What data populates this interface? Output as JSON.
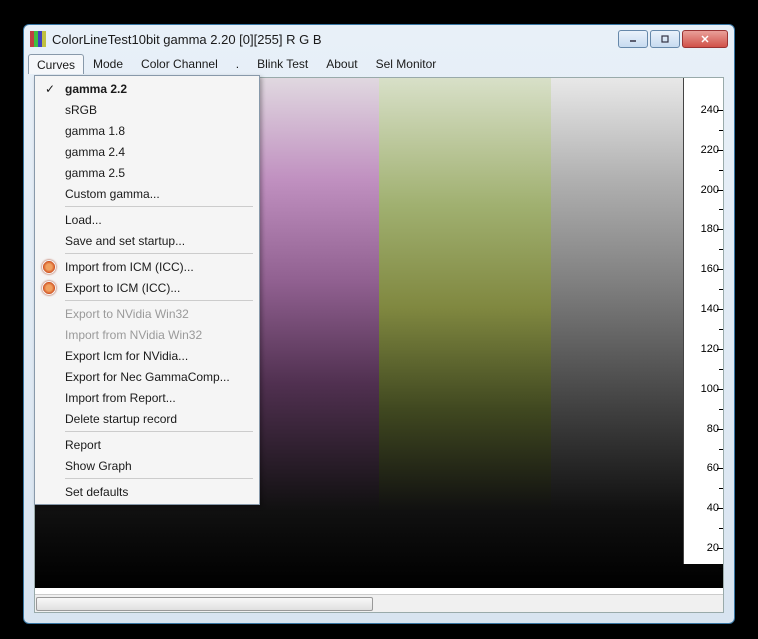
{
  "window": {
    "title": "ColorLineTest10bit gamma 2.20 [0][255]   R G B"
  },
  "menubar": {
    "items": [
      {
        "label": "Curves",
        "open": true
      },
      {
        "label": "Mode"
      },
      {
        "label": "Color Channel"
      },
      {
        "label": "."
      },
      {
        "label": "Blink Test"
      },
      {
        "label": "About"
      },
      {
        "label": "Sel Monitor"
      }
    ]
  },
  "dropdown": {
    "groups": [
      [
        {
          "label": "gamma 2.2",
          "selected": true
        },
        {
          "label": "sRGB"
        },
        {
          "label": "gamma 1.8"
        },
        {
          "label": "gamma 2.4"
        },
        {
          "label": "gamma 2.5"
        },
        {
          "label": "Custom gamma..."
        }
      ],
      [
        {
          "label": "Load..."
        },
        {
          "label": "Save and set startup..."
        }
      ],
      [
        {
          "label": "Import from ICM (ICC)...",
          "icon": "gear"
        },
        {
          "label": "Export to ICM (ICC)...",
          "icon": "gear"
        }
      ],
      [
        {
          "label": "Export to NVidia Win32",
          "disabled": true
        },
        {
          "label": "Import from NVidia Win32",
          "disabled": true
        },
        {
          "label": "Export Icm for NVidia..."
        },
        {
          "label": "Export for Nec GammaComp..."
        },
        {
          "label": "Import from Report..."
        },
        {
          "label": "Delete startup record"
        }
      ],
      [
        {
          "label": "Report"
        },
        {
          "label": "Show Graph"
        }
      ],
      [
        {
          "label": "Set defaults"
        }
      ]
    ]
  },
  "ruler": {
    "ticks": [
      240,
      220,
      200,
      180,
      160,
      140,
      120,
      100,
      80,
      60,
      40,
      20
    ],
    "max": 256
  }
}
